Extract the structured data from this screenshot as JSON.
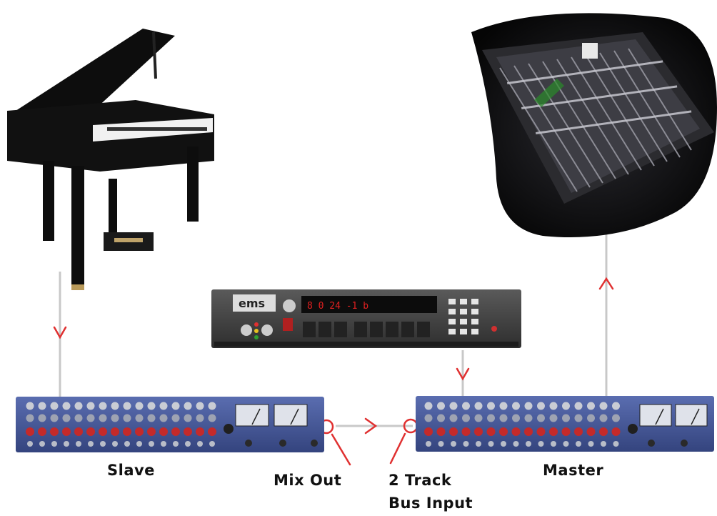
{
  "labels": {
    "slave": "Slave",
    "master": "Master",
    "mix_out": "Mix Out",
    "bus_input_line1": "2 Track",
    "bus_input_line2": "Bus Input"
  },
  "colors": {
    "arrow": "#e03030",
    "connector": "#c8c8c8",
    "rack_blue": "#3e4f8c",
    "knob_red": "#c42a2a",
    "console_bg": "#1a1a1a",
    "piano_black": "#111111"
  },
  "nodes": [
    {
      "id": "piano",
      "icon": "grand-piano-icon"
    },
    {
      "id": "console",
      "icon": "mixing-console-icon"
    },
    {
      "id": "reverb-unit",
      "icon": "rack-effects-unit-icon"
    },
    {
      "id": "slave-mixer",
      "icon": "rack-mixer-icon"
    },
    {
      "id": "master-mixer",
      "icon": "rack-mixer-icon"
    }
  ]
}
